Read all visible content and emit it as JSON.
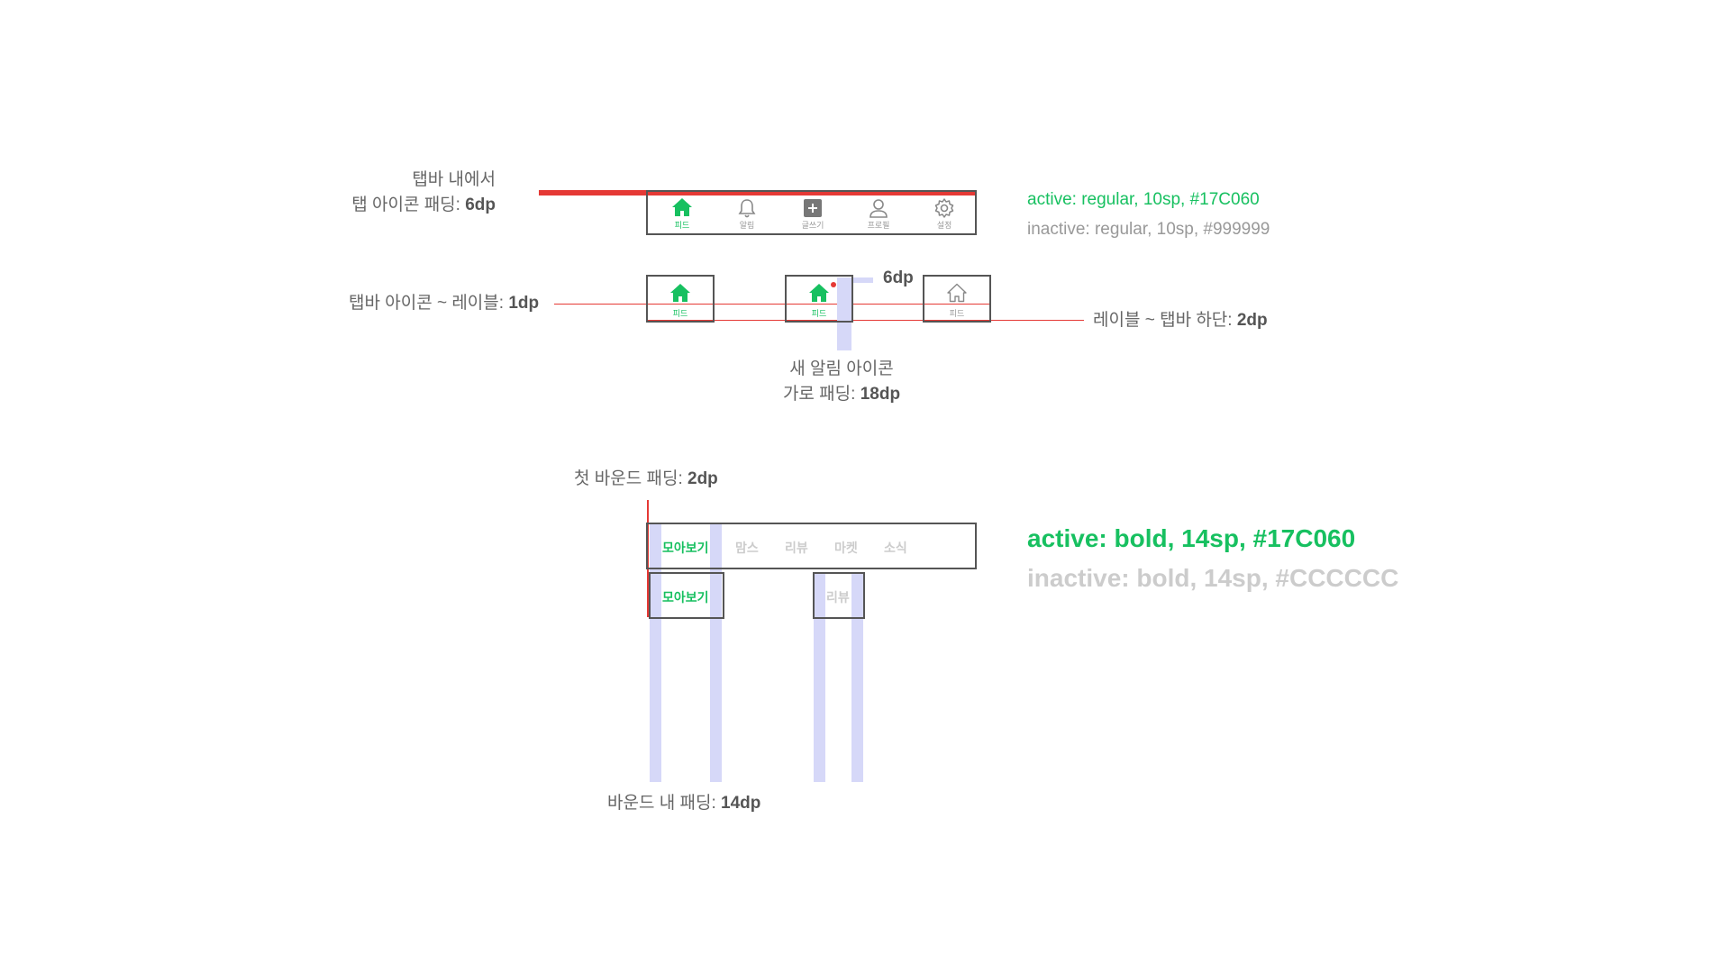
{
  "colors": {
    "active": "#17C060",
    "inactive_small": "#999999",
    "inactive_bold": "#CCCCCC",
    "guide_red": "#e53935",
    "guide_padding": "#d6d8f8",
    "outline": "#555555"
  },
  "annotations": {
    "tab_icon_padding": {
      "line1": "탭바 내에서",
      "line2_prefix": "탭 아이콘 패딩: ",
      "line2_value": "6dp"
    },
    "icon_to_label": {
      "prefix": "탭바 아이콘 ~ 레이블: ",
      "value": "1dp"
    },
    "label_to_bottom": {
      "prefix": "레이블 ~ 탭바 하단: ",
      "value": "2dp"
    },
    "badge_offset": "6dp",
    "new_alert_padding": {
      "line1": "새 알림 아이콘",
      "line2_prefix": "가로 패딩: ",
      "line2_value": "18dp"
    },
    "first_bound_padding": {
      "prefix": "첫 바운드 패딩: ",
      "value": "2dp"
    },
    "inner_bound_padding": {
      "prefix": "바운드 내 패딩: ",
      "value": "14dp"
    }
  },
  "tabbar": {
    "tabs": [
      {
        "label": "피드",
        "icon": "home-icon",
        "active": true
      },
      {
        "label": "알림",
        "icon": "bell-icon",
        "active": false
      },
      {
        "label": "글쓰기",
        "icon": "plus-square-icon",
        "active": false
      },
      {
        "label": "프로필",
        "icon": "person-icon",
        "active": false
      },
      {
        "label": "설정",
        "icon": "gear-icon",
        "active": false
      }
    ],
    "examples": [
      {
        "label": "피드",
        "icon": "home-icon",
        "state": "active"
      },
      {
        "label": "피드",
        "icon": "home-icon",
        "state": "active-with-badge"
      },
      {
        "label": "피드",
        "icon": "home-outline-icon",
        "state": "inactive"
      }
    ]
  },
  "tab_text_spec": {
    "active": "active: regular, 10sp, #17C060",
    "inactive": "inactive: regular, 10sp, #999999"
  },
  "category_bar": {
    "items": [
      {
        "label": "모아보기",
        "active": true
      },
      {
        "label": "맘스",
        "active": false
      },
      {
        "label": "리뷰",
        "active": false
      },
      {
        "label": "마켓",
        "active": false
      },
      {
        "label": "소식",
        "active": false
      }
    ],
    "examples": [
      {
        "label": "모아보기",
        "active": true
      },
      {
        "label": "리뷰",
        "active": false
      }
    ]
  },
  "category_text_spec": {
    "active": "active: bold, 14sp, #17C060",
    "inactive": "inactive: bold, 14sp, #CCCCCC"
  }
}
